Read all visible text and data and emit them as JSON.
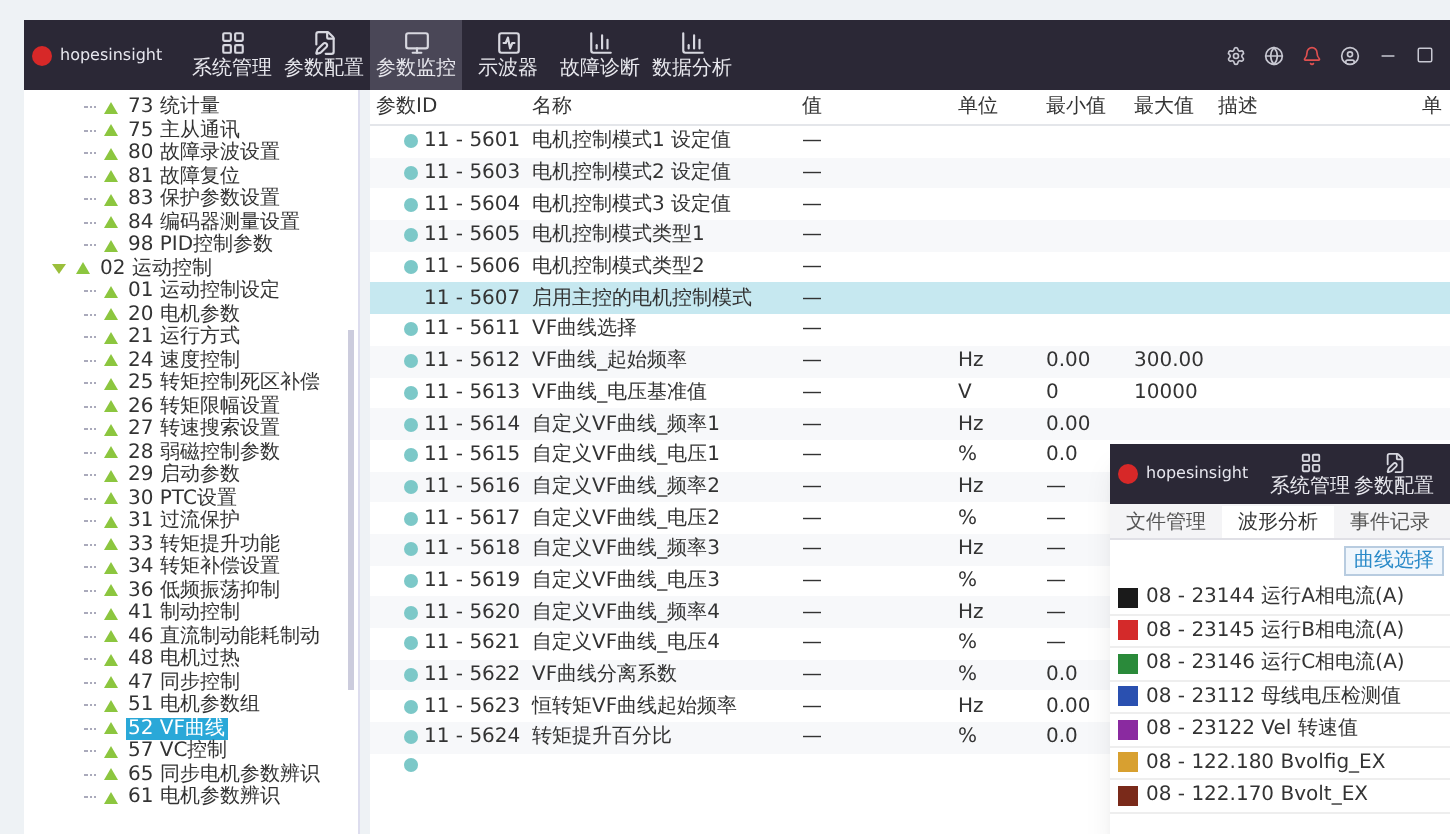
{
  "app": {
    "logo_text": "hopesinsight"
  },
  "nav": [
    {
      "label": "系统管理",
      "selected": false
    },
    {
      "label": "参数配置",
      "selected": false
    },
    {
      "label": "参数监控",
      "selected": true
    },
    {
      "label": "示波器",
      "selected": false
    },
    {
      "label": "故障诊断",
      "selected": false
    },
    {
      "label": "数据分析",
      "selected": false
    }
  ],
  "tree": [
    {
      "children": [
        {
          "label": "73 统计量"
        },
        {
          "label": "75 主从通讯"
        },
        {
          "label": "80 故障录波设置"
        },
        {
          "label": "81 故障复位"
        },
        {
          "label": "83 保护参数设置"
        },
        {
          "label": "84 编码器测量设置"
        },
        {
          "label": "98 PID控制参数"
        }
      ]
    },
    {
      "label": "02 运动控制",
      "expanded": true,
      "children": [
        {
          "label": "01 运动控制设定",
          "selected": false
        },
        {
          "label": "20 电机参数",
          "selected": false
        },
        {
          "label": "21 运行方式",
          "selected": false
        },
        {
          "label": "24 速度控制",
          "selected": false
        },
        {
          "label": "25 转矩控制死区补偿",
          "selected": false
        },
        {
          "label": "26 转矩限幅设置",
          "selected": false
        },
        {
          "label": "27 转速搜索设置",
          "selected": false
        },
        {
          "label": "28 弱磁控制参数",
          "selected": false
        },
        {
          "label": "29 启动参数",
          "selected": false
        },
        {
          "label": "30 PTC设置",
          "selected": false
        },
        {
          "label": "31 过流保护",
          "selected": false
        },
        {
          "label": "33 转矩提升功能",
          "selected": false
        },
        {
          "label": "34 转矩补偿设置",
          "selected": false
        },
        {
          "label": "36 低频振荡抑制",
          "selected": false
        },
        {
          "label": "41 制动控制",
          "selected": false
        },
        {
          "label": "46 直流制动能耗制动",
          "selected": false
        },
        {
          "label": "48 电机过热",
          "selected": false
        },
        {
          "label": "47 同步控制",
          "selected": false
        },
        {
          "label": "51 电机参数组",
          "selected": false
        },
        {
          "label": "52 VF曲线",
          "selected": true
        },
        {
          "label": "57 VC控制",
          "selected": false
        },
        {
          "label": "65 同步电机参数辨识",
          "selected": false
        },
        {
          "label": "61 电机参数辨识",
          "selected": false
        }
      ]
    }
  ],
  "table": {
    "columns": [
      "参数ID",
      "名称",
      "值",
      "单位",
      "最小值",
      "最大值",
      "描述",
      "单"
    ],
    "rows": [
      {
        "cells": [
          "11 - 5601",
          "电机控制模式1 设定值",
          "—",
          "",
          "",
          "",
          ""
        ],
        "selected": false
      },
      {
        "cells": [
          "11 - 5603",
          "电机控制模式2 设定值",
          "—",
          "",
          "",
          "",
          ""
        ],
        "selected": false
      },
      {
        "cells": [
          "11 - 5604",
          "电机控制模式3 设定值",
          "—",
          "",
          "",
          "",
          ""
        ],
        "selected": false
      },
      {
        "cells": [
          "11 - 5605",
          "电机控制模式类型1",
          "—",
          "",
          "",
          "",
          ""
        ],
        "selected": false
      },
      {
        "cells": [
          "11 - 5606",
          "电机控制模式类型2",
          "—",
          "",
          "",
          "",
          ""
        ],
        "selected": false
      },
      {
        "cells": [
          "11 - 5607",
          "启用主控的电机控制模式",
          "—",
          "",
          "",
          "",
          ""
        ],
        "selected": true
      },
      {
        "cells": [
          "11 - 5611",
          "VF曲线选择",
          "—",
          "",
          "",
          "",
          ""
        ],
        "selected": false
      },
      {
        "cells": [
          "11 - 5612",
          "VF曲线_起始频率",
          "—",
          "Hz",
          "0.00",
          "300.00",
          ""
        ],
        "selected": false
      },
      {
        "cells": [
          "11 - 5613",
          "VF曲线_电压基准值",
          "—",
          "V",
          "0",
          "10000",
          ""
        ],
        "selected": false
      },
      {
        "cells": [
          "11 - 5614",
          "自定义VF曲线_频率1",
          "—",
          "Hz",
          "0.00",
          "",
          ""
        ],
        "selected": false
      },
      {
        "cells": [
          "11 - 5615",
          "自定义VF曲线_电压1",
          "—",
          "%",
          "0.0",
          "",
          ""
        ],
        "selected": false
      },
      {
        "cells": [
          "11 - 5616",
          "自定义VF曲线_频率2",
          "—",
          "Hz",
          "—",
          "",
          ""
        ],
        "selected": false
      },
      {
        "cells": [
          "11 - 5617",
          "自定义VF曲线_电压2",
          "—",
          "%",
          "—",
          "",
          ""
        ],
        "selected": false
      },
      {
        "cells": [
          "11 - 5618",
          "自定义VF曲线_频率3",
          "—",
          "Hz",
          "—",
          "",
          ""
        ],
        "selected": false
      },
      {
        "cells": [
          "11 - 5619",
          "自定义VF曲线_电压3",
          "—",
          "%",
          "—",
          "",
          ""
        ],
        "selected": false
      },
      {
        "cells": [
          "11 - 5620",
          "自定义VF曲线_频率4",
          "—",
          "Hz",
          "—",
          "",
          ""
        ],
        "selected": false
      },
      {
        "cells": [
          "11 - 5621",
          "自定义VF曲线_电压4",
          "—",
          "%",
          "—",
          "",
          ""
        ],
        "selected": false
      },
      {
        "cells": [
          "11 - 5622",
          "VF曲线分离系数",
          "—",
          "%",
          "0.0",
          "",
          ""
        ],
        "selected": false
      },
      {
        "cells": [
          "11 - 5623",
          "恒转矩VF曲线起始频率",
          "—",
          "Hz",
          "0.00",
          "",
          ""
        ],
        "selected": false
      },
      {
        "cells": [
          "11 - 5624",
          "转矩提升百分比",
          "—",
          "%",
          "0.0",
          "",
          ""
        ],
        "selected": false
      }
    ]
  },
  "popup": {
    "logo_text": "hopesinsight",
    "nav": [
      {
        "label": "系统管理"
      },
      {
        "label": "参数配置"
      }
    ],
    "tabs": [
      {
        "label": "文件管理",
        "selected": false
      },
      {
        "label": "波形分析",
        "selected": true
      },
      {
        "label": "事件记录",
        "selected": false
      }
    ],
    "button": "曲线选择",
    "legend": [
      {
        "label": "08 - 23144 运行A相电流(A)",
        "color": "#1a1a1a"
      },
      {
        "label": "08 - 23145 运行B相电流(A)",
        "color": "#d42a2a"
      },
      {
        "label": "08 - 23146 运行C相电流(A)",
        "color": "#2a8a3a"
      },
      {
        "label": "08 - 23112 母线电压检测值",
        "color": "#2a50b0"
      },
      {
        "label": "08 - 23122 Vel 转速值",
        "color": "#8a2aa0"
      },
      {
        "label": "08 - 122.180 Bvolfig_EX",
        "color": "#d8a030"
      },
      {
        "label": "08 - 122.170 Bvolt_EX",
        "color": "#7a2a1a"
      }
    ]
  }
}
